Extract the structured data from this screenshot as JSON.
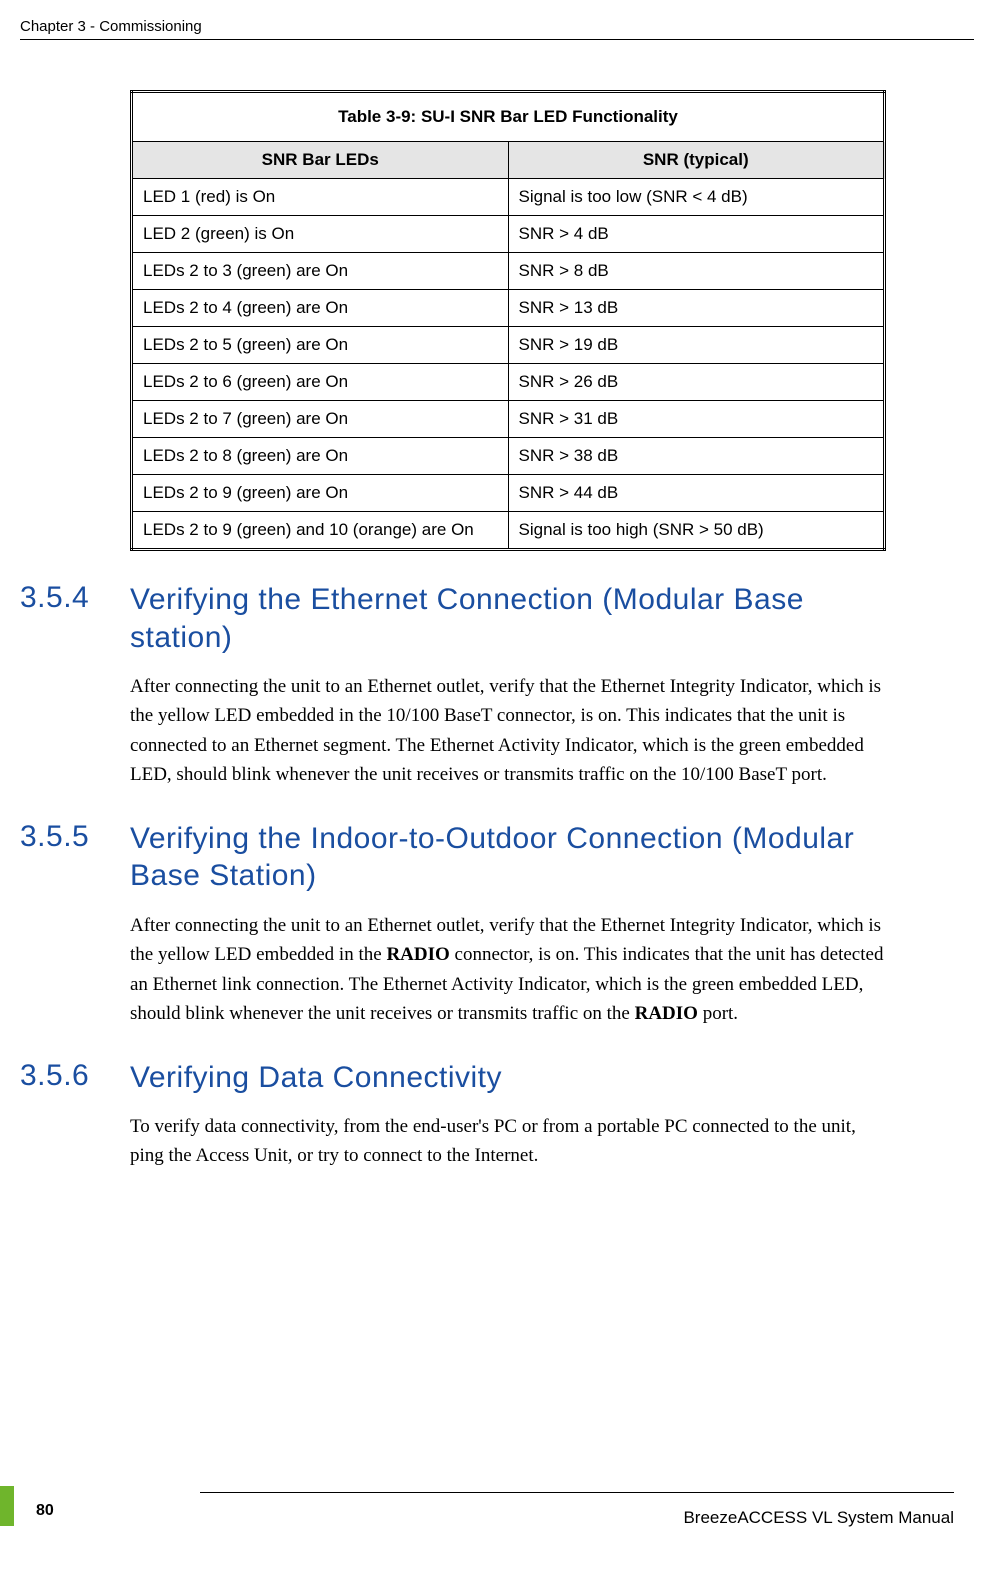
{
  "header": {
    "chapter": "Chapter 3 - Commissioning"
  },
  "table": {
    "caption": "Table 3-9: SU-I SNR Bar LED Functionality",
    "col1_head": "SNR Bar LEDs",
    "col2_head": "SNR (typical)",
    "rows": [
      {
        "c1": "LED 1 (red) is On",
        "c2": "Signal is too low (SNR < 4 dB)"
      },
      {
        "c1": "LED 2 (green) is On",
        "c2": "SNR > 4 dB"
      },
      {
        "c1": "LEDs 2 to 3 (green) are On",
        "c2": "SNR > 8 dB"
      },
      {
        "c1": "LEDs 2 to 4 (green) are On",
        "c2": "SNR > 13 dB"
      },
      {
        "c1": "LEDs 2 to 5 (green) are On",
        "c2": "SNR > 19 dB"
      },
      {
        "c1": "LEDs 2 to 6 (green) are On",
        "c2": "SNR > 26 dB"
      },
      {
        "c1": "LEDs 2 to 7 (green) are On",
        "c2": "SNR > 31 dB"
      },
      {
        "c1": "LEDs 2 to 8 (green) are On",
        "c2": "SNR > 38 dB"
      },
      {
        "c1": "LEDs 2 to 9 (green) are On",
        "c2": "SNR > 44 dB"
      },
      {
        "c1": "LEDs 2 to 9 (green) and 10 (orange) are On",
        "c2": "Signal is too high (SNR > 50 dB)"
      }
    ]
  },
  "sections": [
    {
      "num": "3.5.4",
      "title": "Verifying the Ethernet Connection (Modular Base station)",
      "body_html": "After connecting the unit to an Ethernet outlet, verify that the Ethernet Integrity Indicator, which is the yellow LED embedded in the 10/100 BaseT connector, is on. This indicates that the unit is connected to an Ethernet segment. The Ethernet Activity Indicator, which is the green embedded LED, should blink whenever the unit receives or transmits traffic on the 10/100 BaseT port."
    },
    {
      "num": "3.5.5",
      "title": "Verifying the Indoor-to-Outdoor Connection (Modular Base Station)",
      "body_html": "After connecting the unit to an Ethernet outlet, verify that the Ethernet Integrity Indicator, which is the yellow LED embedded in the <b>RADIO</b> connector, is on. This indicates that the unit has detected an Ethernet link connection. The Ethernet Activity Indicator, which is the green embedded LED, should blink whenever the unit receives or transmits traffic on the <b>RADIO</b> port."
    },
    {
      "num": "3.5.6",
      "title": "Verifying Data Connectivity",
      "body_html": "To verify data connectivity, from the end-user's PC or from a portable PC connected to the unit, ping the Access Unit, or try to connect to the Internet."
    }
  ],
  "footer": {
    "page": "80",
    "manual": "BreezeACCESS VL System Manual"
  }
}
